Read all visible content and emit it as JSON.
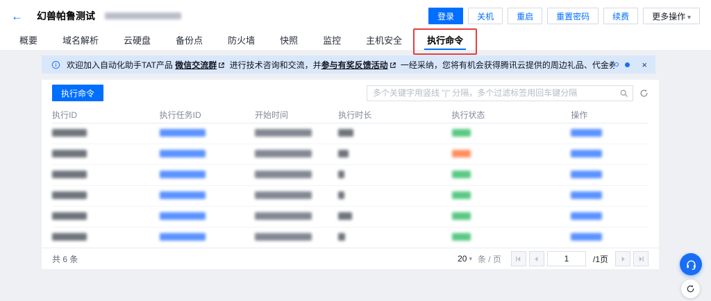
{
  "header": {
    "back_icon": "←",
    "title": "幻兽帕鲁测试",
    "actions": [
      {
        "name": "login-button",
        "label": "登录",
        "type": "primary"
      },
      {
        "name": "shutdown-button",
        "label": "关机"
      },
      {
        "name": "restart-button",
        "label": "重启"
      },
      {
        "name": "reset-password-button",
        "label": "重置密码"
      },
      {
        "name": "renew-button",
        "label": "续费"
      },
      {
        "name": "more-actions-button",
        "label": "更多操作",
        "caret": "▾"
      }
    ]
  },
  "tabs": {
    "items": [
      "概要",
      "域名解析",
      "云硬盘",
      "备份点",
      "防火墙",
      "快照",
      "监控",
      "主机安全",
      "执行命令"
    ],
    "active_index": 8
  },
  "banner": {
    "text1": "欢迎加入自动化助手TAT产品 ",
    "link1": "微信交流群",
    "text2": " 进行技术咨询和交流，并",
    "link2": "参与有奖反馈活动",
    "text3": " 一经采纳，您将有机会获得腾讯云提供的周边礼品、代金券等神秘奖励！",
    "close_icon": "×"
  },
  "toolbar": {
    "execute_button": "执行命令",
    "search_placeholder": "多个关键字用竖线 \"|\" 分隔，多个过滤标签用回车键分隔"
  },
  "table": {
    "columns": [
      "执行ID",
      "执行任务ID",
      "开始时间",
      "执行时长",
      "执行状态",
      "操作"
    ],
    "rows": [
      {
        "status": "success",
        "dur_w": 22
      },
      {
        "status": "failed",
        "dur_w": 15
      },
      {
        "status": "success",
        "dur_w": 9
      },
      {
        "status": "success",
        "dur_w": 9
      },
      {
        "status": "success",
        "dur_w": 20
      },
      {
        "status": "success",
        "dur_w": 10
      }
    ],
    "status_colors": {
      "success": "#3dbf6e",
      "failed": "#ff7a45"
    }
  },
  "footer": {
    "total": "共 6 条",
    "page_size": "20",
    "page_size_caret": "▾",
    "page_size_unit": "条 / 页",
    "page_input": "1",
    "page_total": "/1页"
  },
  "icons": {
    "info": "info-circle",
    "external_link": "external-link",
    "search": "magnifier",
    "refresh": "circular-arrow",
    "support": "headset",
    "float_refresh": "circular-arrow"
  }
}
